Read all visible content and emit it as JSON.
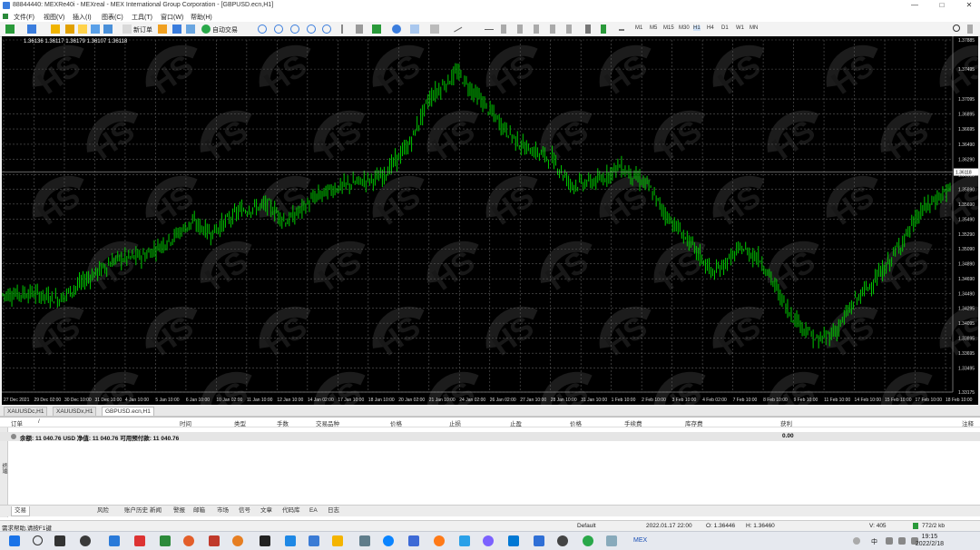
{
  "window": {
    "title": "88844440: MEXRe40i - MEXreal - MEX International Group Corporation - [GBPUSD.ecn,H1]",
    "btn_min": "—",
    "btn_max": "□",
    "btn_close": "✕"
  },
  "menu": [
    "文件(F)",
    "视图(V)",
    "插入(I)",
    "图表(C)",
    "工具(T)",
    "窗口(W)",
    "帮助(H)"
  ],
  "toolbar": {
    "new_order": "新订单",
    "auto_trading": "自动交易",
    "timeframes": [
      "M1",
      "M5",
      "M15",
      "M30",
      "H1",
      "H4",
      "D1",
      "W1",
      "MN"
    ]
  },
  "chart": {
    "ohlc_label": "1.36136 1.36117 1.36179 1.36107 1.36118",
    "watermark": "HS",
    "current_price": "1.36118",
    "colors": {
      "background": "#000000",
      "candle": "#00c800",
      "grid": "#5a5a5a",
      "price_line": "#9a9a9a"
    }
  },
  "chart_data": {
    "type": "line",
    "title": "",
    "xlabel": "",
    "ylabel": "",
    "ylim": [
      1.33175,
      1.37885
    ],
    "y_ticks": [
      "1.37885",
      "1.37495",
      "1.37095",
      "1.36895",
      "1.36695",
      "1.36490",
      "1.36290",
      "1.36085",
      "1.35890",
      "1.35690",
      "1.35490",
      "1.35290",
      "1.35090",
      "1.34890",
      "1.34690",
      "1.34490",
      "1.34295",
      "1.34095",
      "1.33895",
      "1.33695",
      "1.33495",
      "1.33175"
    ],
    "x_ticks": [
      "27 Dec 2021",
      "29 Dec 02:00",
      "30 Dec 10:00",
      "31 Dec 10:00",
      "4 Jan 10:00",
      "5 Jan 10:00",
      "6 Jan 10:00",
      "10 Jan 02:00",
      "11 Jan 10:00",
      "12 Jan 10:00",
      "14 Jan 02:00",
      "17 Jan 10:00",
      "18 Jan 10:00",
      "20 Jan 02:00",
      "21 Jan 10:00",
      "24 Jan 02:00",
      "26 Jan 02:00",
      "27 Jan 10:00",
      "28 Jan 10:00",
      "31 Jan 10:00",
      "1 Feb 10:00",
      "2 Feb 10:00",
      "3 Feb 10:00",
      "4 Feb 02:00",
      "7 Feb 10:00",
      "8 Feb 10:00",
      "9 Feb 10:00",
      "11 Feb 10:00",
      "14 Feb 10:00",
      "15 Feb 10:00",
      "17 Feb 10:00",
      "18 Feb 10:00"
    ],
    "series": [
      {
        "x": [
          0,
          3,
          6,
          9,
          12,
          15,
          18,
          20,
          22,
          25,
          28,
          30,
          33,
          35,
          38,
          40,
          43,
          45,
          48,
          50,
          53,
          55,
          58,
          60,
          63,
          65,
          68,
          70,
          73,
          75,
          78,
          80,
          83,
          86,
          88,
          90,
          93,
          95,
          97,
          100
        ],
        "values": [
          1.3448,
          1.345,
          1.3442,
          1.347,
          1.3495,
          1.35,
          1.3525,
          1.3545,
          1.353,
          1.356,
          1.3568,
          1.3545,
          1.3578,
          1.359,
          1.36,
          1.3605,
          1.365,
          1.371,
          1.3745,
          1.3715,
          1.367,
          1.3645,
          1.363,
          1.3595,
          1.36,
          1.362,
          1.3595,
          1.3555,
          1.351,
          1.3475,
          1.351,
          1.3495,
          1.3425,
          1.3385,
          1.34,
          1.344,
          1.348,
          1.352,
          1.356,
          1.359
        ]
      }
    ]
  },
  "tabs": [
    "XAUUSDc,H1",
    "XAUUSDx,H1",
    "GBPUSD.ecn,H1"
  ],
  "terminal": {
    "headers": [
      "订单",
      "/",
      "时间",
      "类型",
      "手数",
      "交易品种",
      "价格",
      "止损",
      "止盈",
      "价格",
      "手续费",
      "库存费",
      "获利",
      "注释"
    ],
    "balance": "余额: 11 040.76 USD  净值: 11 040.76  可用预付款: 11 040.76",
    "profit": "0.00"
  },
  "terminal_tabs": [
    "交易",
    "风险",
    "账户历史",
    "新闻",
    "警报",
    "邮箱",
    "市场",
    "信号",
    "文章",
    "代码库",
    "EA",
    "日志"
  ],
  "side_label": "终端",
  "status": {
    "help": "需求帮助,请按F1键",
    "default": "Default",
    "datetime": "2022.01.17 22:00",
    "open": "O: 1.36446",
    "high": "H: 1.36460",
    "volume": "V: 405",
    "traffic": "772/2 kb"
  },
  "taskbar": {
    "time": "19:15",
    "date": "2022/2/18",
    "lang": "中",
    "app_label": "MEX"
  }
}
